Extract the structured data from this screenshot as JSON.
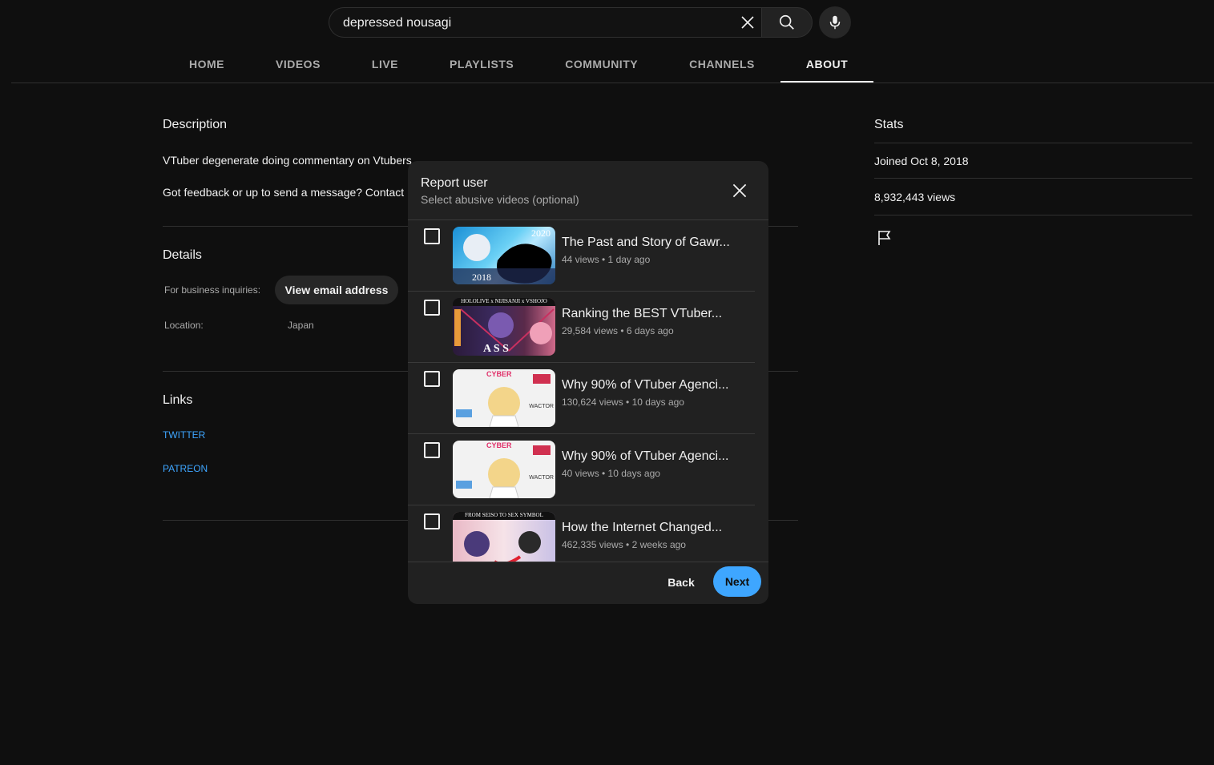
{
  "search": {
    "value": "depressed nousagi"
  },
  "tabs": [
    "HOME",
    "VIDEOS",
    "LIVE",
    "PLAYLISTS",
    "COMMUNITY",
    "CHANNELS",
    "ABOUT"
  ],
  "active_tab": "ABOUT",
  "about": {
    "description_heading": "Description",
    "description_line1": "VTuber degenerate doing commentary on Vtubers",
    "description_line2": "Got feedback or up to send a message? Contact r",
    "details_heading": "Details",
    "business_label": "For business inquiries:",
    "email_button": "View email address",
    "location_label": "Location:",
    "location_value": "Japan",
    "links_heading": "Links",
    "links": [
      "TWITTER",
      "PATREON"
    ]
  },
  "stats": {
    "heading": "Stats",
    "joined": "Joined Oct 8, 2018",
    "views": "8,932,443 views"
  },
  "modal": {
    "title": "Report user",
    "subtitle": "Select abusive videos (optional)",
    "videos": [
      {
        "title": "The Past and Story of Gawr...",
        "meta": "44 views • 1 day ago",
        "thumb_text_top": "2020",
        "thumb_text_bottom": "2018"
      },
      {
        "title": "Ranking the BEST VTuber...",
        "meta": "29,584 views • 6 days ago",
        "thumb_text_top": "HOLOLIVE x NIJISANJI x VSHOJO",
        "thumb_text_bottom": "A S S"
      },
      {
        "title": "Why 90% of VTuber Agenci...",
        "meta": "130,624 views • 10 days ago",
        "thumb_text_top": "CYBER",
        "thumb_text_bottom": "WACTOR"
      },
      {
        "title": "Why 90% of VTuber Agenci...",
        "meta": "40 views • 10 days ago",
        "thumb_text_top": "CYBER",
        "thumb_text_bottom": "WACTOR"
      },
      {
        "title": "How the Internet Changed...",
        "meta": "462,335 views • 2 weeks ago",
        "thumb_text_top": "FROM SEISO TO SEX SYMBOL",
        "thumb_text_bottom": ""
      }
    ],
    "back_label": "Back",
    "next_label": "Next"
  },
  "colors": {
    "background": "#0f0f0f",
    "modal": "#212121",
    "accent": "#3ea6ff",
    "link": "#3ea6ff"
  }
}
